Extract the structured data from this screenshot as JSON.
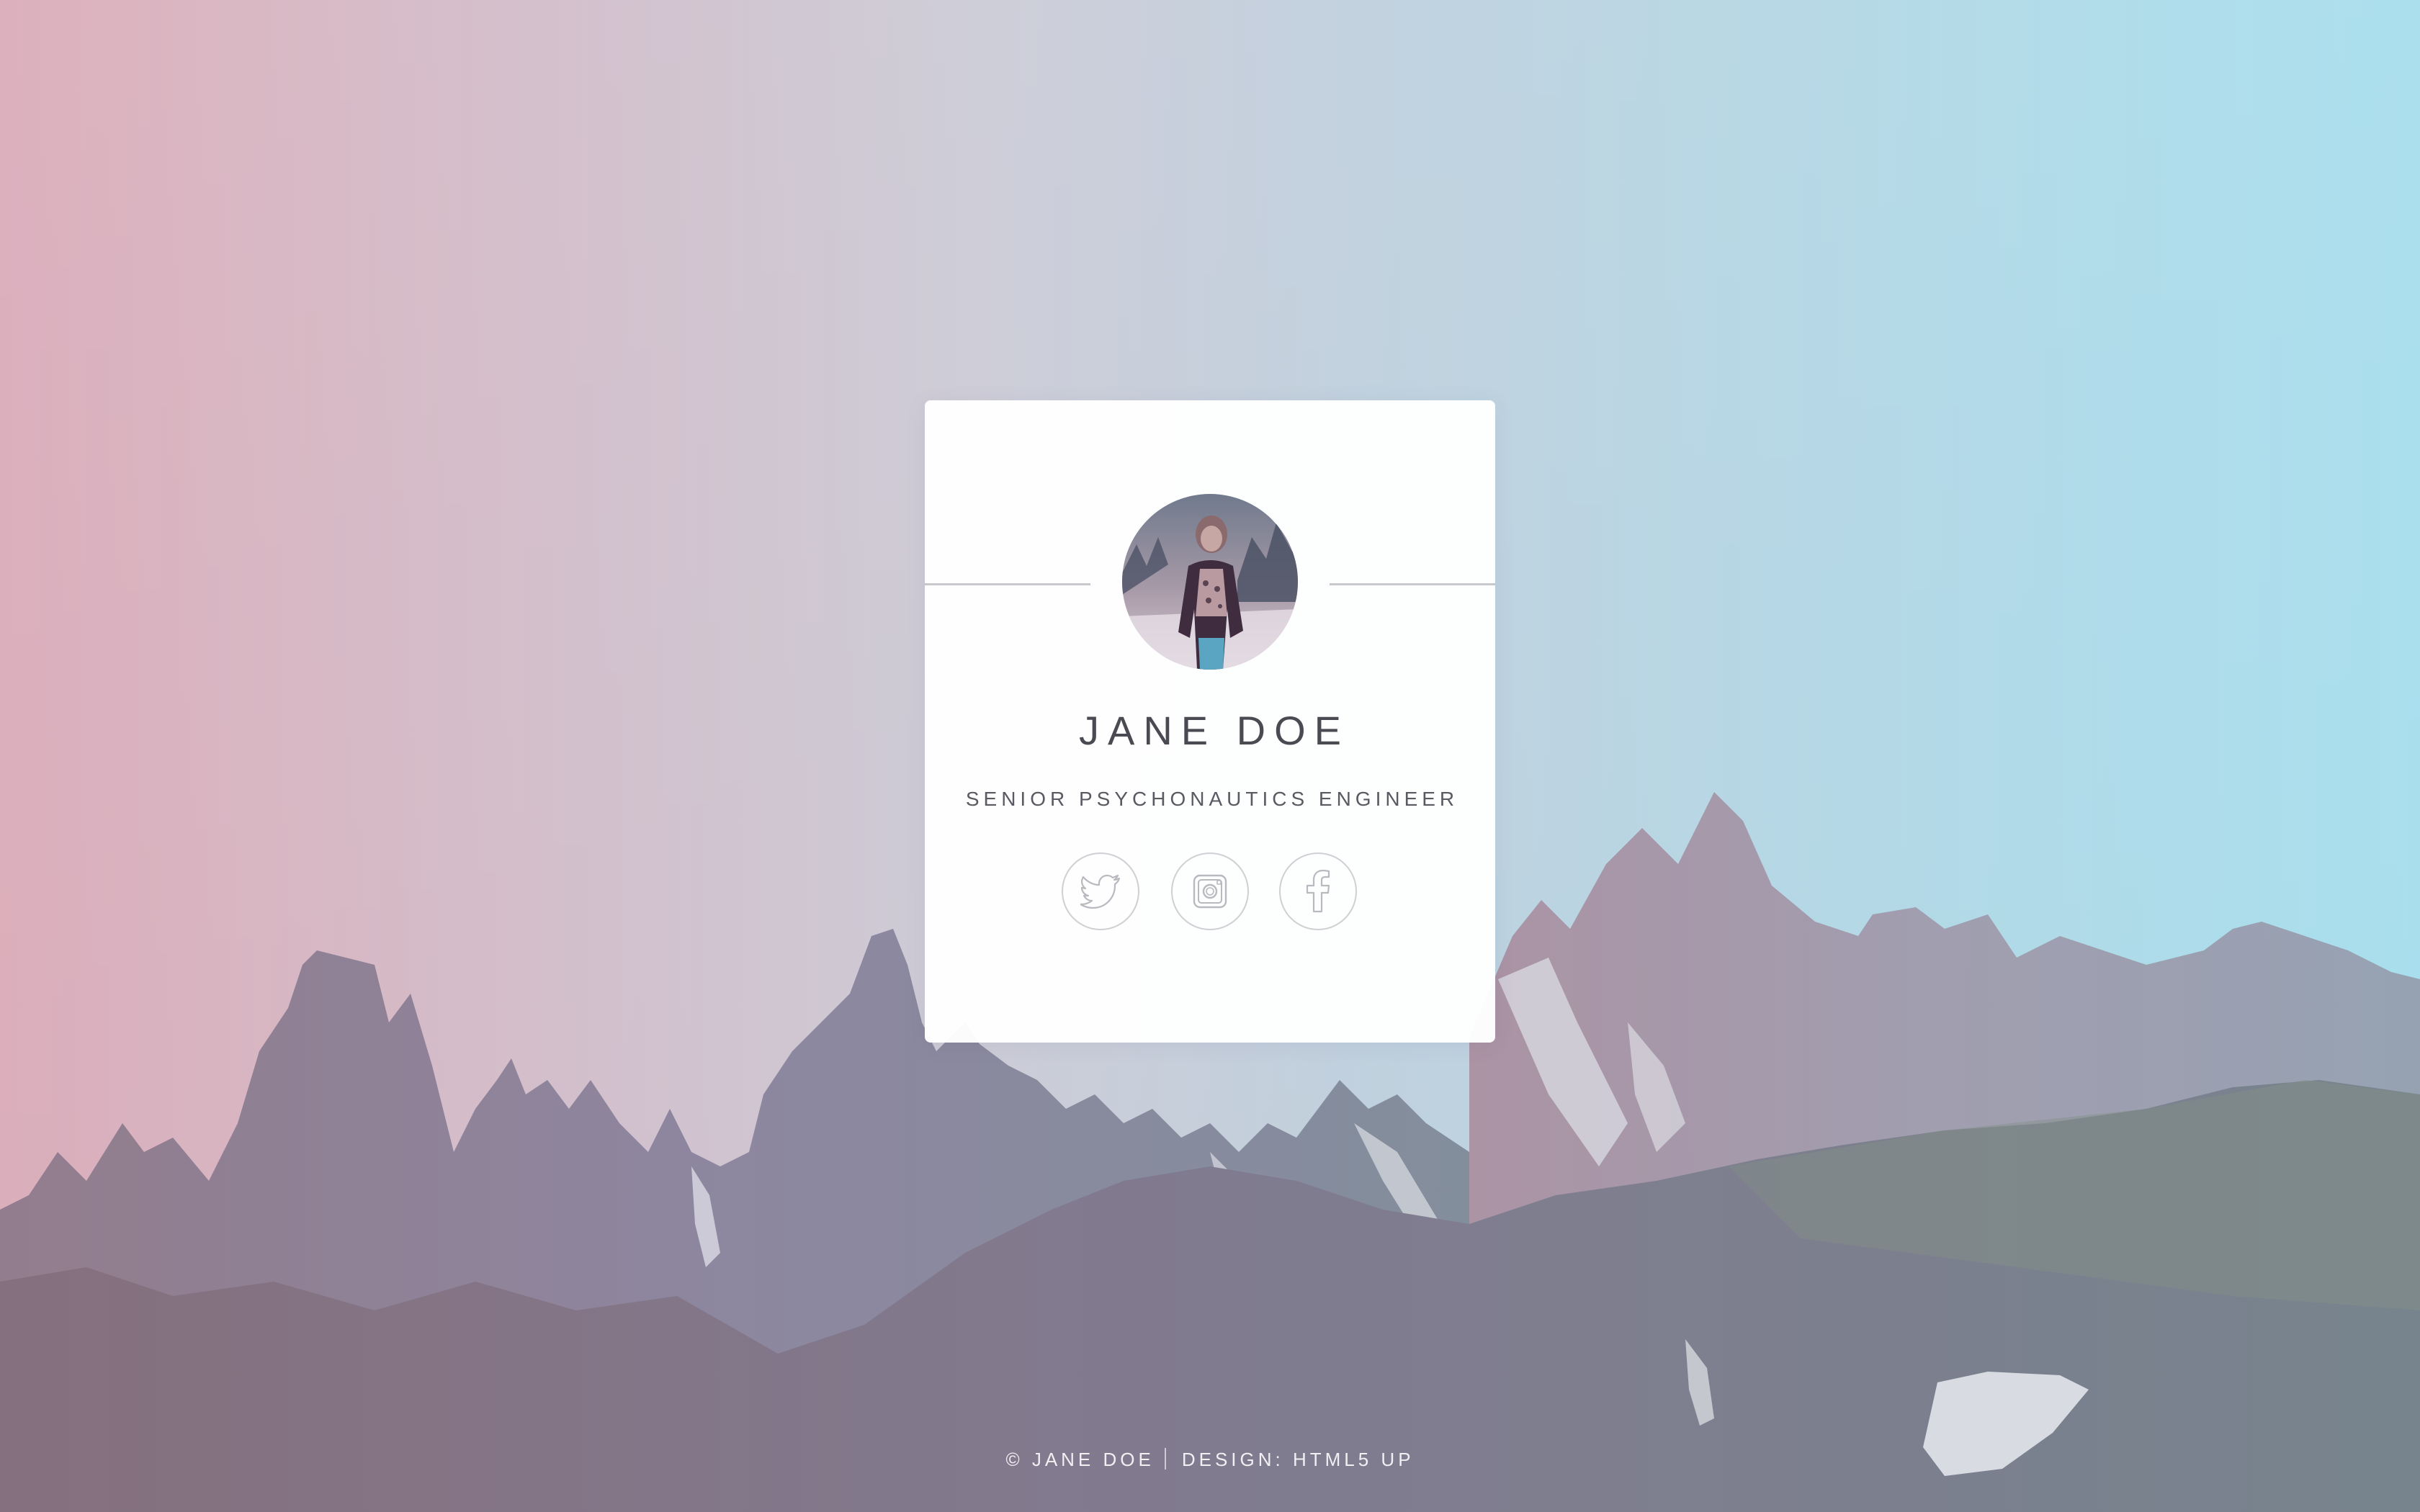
{
  "profile": {
    "name": "JANE DOE",
    "title": "SENIOR PSYCHONAUTICS ENGINEER",
    "avatar_alt": "Jane Doe"
  },
  "socials": [
    {
      "label": "Twitter",
      "icon": "twitter-icon"
    },
    {
      "label": "Instagram",
      "icon": "instagram-icon"
    },
    {
      "label": "Facebook",
      "icon": "facebook-icon"
    }
  ],
  "footer": {
    "copyright": "© JANE DOE",
    "design": "DESIGN: HTML5 UP"
  },
  "colors": {
    "sky_left": "#d7a3b4",
    "sky_center": "#c8ccd8",
    "sky_right": "#a7dcea",
    "card": "#ffffff",
    "text": "#4a4a52"
  }
}
